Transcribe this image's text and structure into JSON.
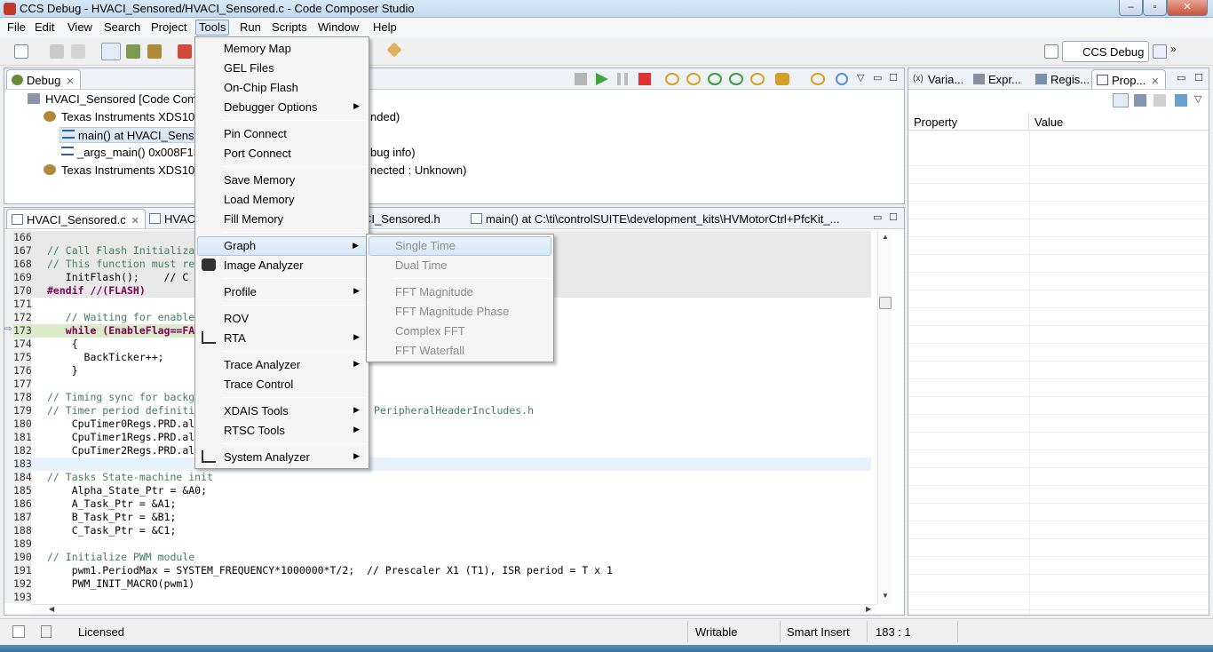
{
  "window": {
    "title": "CCS Debug - HVACI_Sensored/HVACI_Sensored.c - Code Composer Studio",
    "controls": [
      "–",
      "▫",
      "✕"
    ]
  },
  "menubar": [
    "File",
    "Edit",
    "View",
    "Search",
    "Project",
    "Tools",
    "Run",
    "Scripts",
    "Window",
    "Help"
  ],
  "toolbar": {
    "perspective_label": "CCS Debug",
    "overflow": "»"
  },
  "debug_view": {
    "tab_label": "Debug",
    "tree": [
      "HVACI_Sensored [Code Com",
      "Texas Instruments XDS10",
      "main() at HVACI_Senso",
      "_args_main() 0x008F13",
      "Texas Instruments XDS10"
    ],
    "tree_tails": [
      "",
      "nded)",
      "",
      "bug info)",
      "nected : Unknown)"
    ]
  },
  "right_views": {
    "tabs": [
      "Varia...",
      "Expr...",
      "Regis...",
      "Prop..."
    ],
    "columns": [
      "Property",
      "Value"
    ]
  },
  "editor": {
    "tabs": [
      "HVACI_Sensored.c",
      "HVAC",
      "CI_Sensored.h",
      "main() at C:\\ti\\controlSUITE\\development_kits\\HVMotorCtrl+PfcKit_..."
    ],
    "lines": [
      {
        "n": "166",
        "code": ""
      },
      {
        "n": "167",
        "code": "// Call Flash Initializa"
      },
      {
        "n": "168",
        "code": "// This function must re"
      },
      {
        "n": "169",
        "code": "   InitFlash();    // C"
      },
      {
        "n": "170",
        "code": "#endif //(FLASH)"
      },
      {
        "n": "171",
        "code": ""
      },
      {
        "n": "172",
        "code": "   // Waiting for enable"
      },
      {
        "n": "173",
        "code": "   while (EnableFlag==FA"
      },
      {
        "n": "174",
        "code": "    {"
      },
      {
        "n": "175",
        "code": "      BackTicker++;"
      },
      {
        "n": "176",
        "code": "    }"
      },
      {
        "n": "177",
        "code": ""
      },
      {
        "n": "178",
        "code": "// Timing sync for backg"
      },
      {
        "n": "179",
        "code": "// Timer period definiti"
      },
      {
        "n": "180",
        "code": "    CpuTimer0Regs.PRD.al"
      },
      {
        "n": "181",
        "code": "    CpuTimer1Regs.PRD.al"
      },
      {
        "n": "182",
        "code": "    CpuTimer2Regs.PRD.al"
      },
      {
        "n": "183",
        "code": ""
      },
      {
        "n": "184",
        "code": "// Tasks State-machine init"
      },
      {
        "n": "185",
        "code": "    Alpha_State_Ptr = &A0;"
      },
      {
        "n": "186",
        "code": "    A_Task_Ptr = &A1;"
      },
      {
        "n": "187",
        "code": "    B_Task_Ptr = &B1;"
      },
      {
        "n": "188",
        "code": "    C_Task_Ptr = &C1;"
      },
      {
        "n": "189",
        "code": ""
      },
      {
        "n": "190",
        "code": "// Initialize PWM module"
      },
      {
        "n": "191",
        "code": "    pwm1.PeriodMax = SYSTEM_FREQUENCY*1000000*T/2;  // Prescaler X1 (T1), ISR period = T x 1"
      },
      {
        "n": "192",
        "code": "    PWM_INIT_MACRO(pwm1)"
      },
      {
        "n": "193",
        "code": ""
      }
    ],
    "line179_tail": "PeripheralHeaderIncludes.h"
  },
  "tools_menu": [
    "Memory Map",
    "GEL Files",
    "On-Chip Flash",
    "Debugger Options",
    "Pin Connect",
    "Port Connect",
    "Save Memory",
    "Load Memory",
    "Fill Memory",
    "Graph",
    "Image Analyzer",
    "Profile",
    "ROV",
    "RTA",
    "Trace Analyzer",
    "Trace Control",
    "XDAIS Tools",
    "RTSC Tools",
    "System Analyzer"
  ],
  "graph_submenu": [
    "Single Time",
    "Dual Time",
    "FFT Magnitude",
    "FFT Magnitude Phase",
    "Complex FFT",
    "FFT Waterfall"
  ],
  "statusbar": {
    "license": "Licensed",
    "mode": "Writable",
    "insert": "Smart Insert",
    "position": "183 : 1"
  }
}
